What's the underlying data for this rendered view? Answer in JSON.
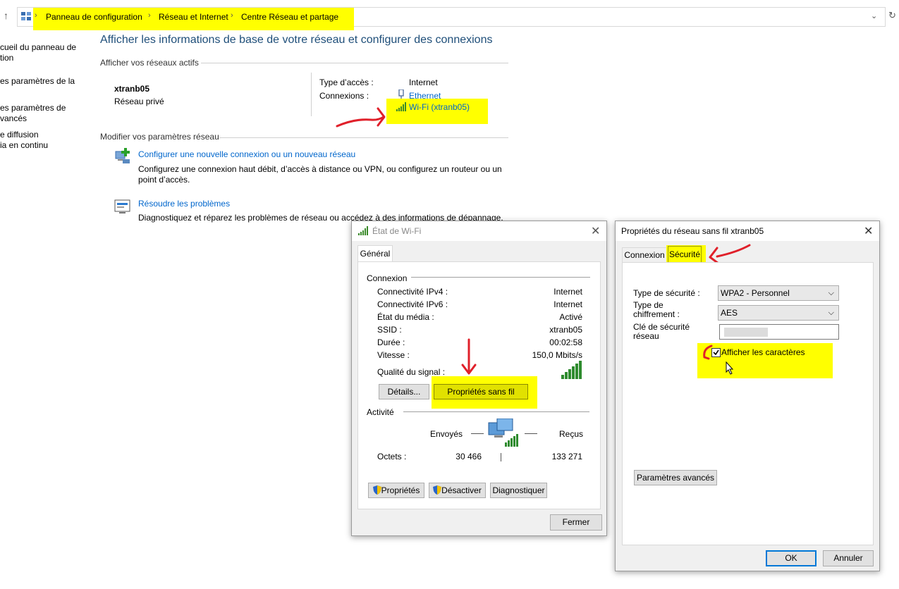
{
  "addressbar": {
    "breadcrumb": [
      "Panneau de configuration",
      "Réseau et Internet",
      "Centre Réseau et partage"
    ]
  },
  "sidebar": {
    "items": [
      {
        "line1": "cueil du panneau de",
        "line2": "tion"
      },
      {
        "line1": "es paramètres de la",
        "line2": ""
      },
      {
        "line1": "es paramètres de",
        "line2": "vancés"
      },
      {
        "line1": "e diffusion",
        "line2": "ia en continu"
      }
    ]
  },
  "main": {
    "title": "Afficher les informations de base de votre réseau et configurer des connexions",
    "active_networks_label": "Afficher vos réseaux actifs",
    "network_name": "xtranb05",
    "network_type": "Réseau privé",
    "access_type_label": "Type d’accès :",
    "access_type_value": "Internet",
    "connections_label": "Connexions :",
    "connection_ethernet": "Ethernet",
    "connection_wifi": "Wi-Fi (xtranb05)",
    "modify_label": "Modifier vos paramètres réseau",
    "task1_title": "Configurer une nouvelle connexion ou un nouveau réseau",
    "task1_desc_line1": "Configurez une connexion haut débit, d’accès à distance ou VPN, ou configurez un routeur ou un",
    "task1_desc_line2": "point d’accès.",
    "task2_title": "Résoudre les problèmes",
    "task2_desc": "Diagnostiquez et réparez les problèmes de réseau ou accédez à des informations de dépannage."
  },
  "wifi_status": {
    "title": "État de Wi-Fi",
    "tab": "Général",
    "connection_group": "Connexion",
    "rows": [
      {
        "label": "Connectivité IPv4 :",
        "value": "Internet"
      },
      {
        "label": "Connectivité IPv6 :",
        "value": "Internet"
      },
      {
        "label": "État du média :",
        "value": "Activé"
      },
      {
        "label": "SSID :",
        "value": "xtranb05"
      },
      {
        "label": "Durée :",
        "value": "00:02:58"
      },
      {
        "label": "Vitesse :",
        "value": "150,0 Mbits/s"
      }
    ],
    "signal_label": "Qualité du signal :",
    "details_button": "Détails...",
    "wireless_props_button": "Propriétés sans fil",
    "activity_group": "Activité",
    "sent_label": "Envoyés",
    "received_label": "Reçus",
    "bytes_label": "Octets :",
    "bytes_sent": "30 466",
    "bytes_received": "133 271",
    "properties_button": "Propriétés",
    "disable_button": "Désactiver",
    "diagnose_button": "Diagnostiquer",
    "close_button": "Fermer"
  },
  "wireless_props": {
    "title": "Propriétés du réseau sans fil xtranb05",
    "tab_connection": "Connexion",
    "tab_security": "Sécurité",
    "security_type_label": "Type de sécurité :",
    "security_type_value": "WPA2 - Personnel",
    "encryption_label_line1": "Type de",
    "encryption_label_line2": "chiffrement :",
    "encryption_value": "AES",
    "key_label_line1": "Clé de sécurité",
    "key_label_line2": "réseau",
    "show_chars_label": "Afficher les caractères",
    "show_chars_checked": true,
    "advanced_button": "Paramètres avancés",
    "ok_button": "OK",
    "cancel_button": "Annuler"
  },
  "colors": {
    "highlight": "#ffff00",
    "link": "#0066cc",
    "annotation_arrow": "#e0202a",
    "heading": "#1e4e79"
  }
}
